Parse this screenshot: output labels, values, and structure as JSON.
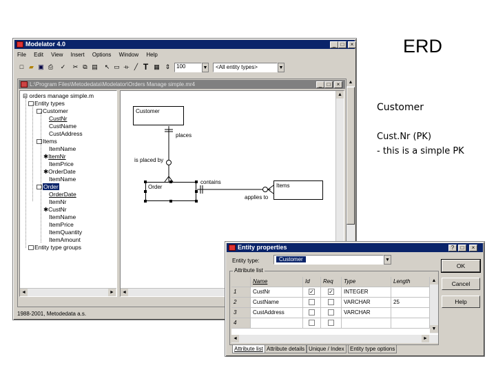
{
  "slide": {
    "title": "ERD",
    "notes": [
      "Customer",
      "Cust.Nr (PK)",
      "- this is a simple PK"
    ]
  },
  "app": {
    "title": "Modelator 4.0",
    "menu": [
      "File",
      "Edit",
      "View",
      "Insert",
      "Options",
      "Window",
      "Help"
    ],
    "zoom": "100",
    "entity_filter": "<All entity types>",
    "status": "1988-2001, Metodedata a.s."
  },
  "child": {
    "title": "L:\\Program Files\\Metodedata\\Modelator\\Orders Manage simple.mr4"
  },
  "tree": {
    "root": "orders manage simple.m",
    "entity_types": "Entity types",
    "customer": "Customer",
    "customer_attrs": [
      "CustNr",
      "CustName",
      "CustAddress"
    ],
    "items": "Items",
    "items_attrs": [
      "ItemName",
      "ItemNr",
      "ItemPrice",
      "OrderDate",
      "ItemName"
    ],
    "order": "Order",
    "order_attrs": [
      "OrderDate",
      "ItemNr",
      "CustNr",
      "ItemName",
      "ItemPrice",
      "ItemQuantity",
      "ItemAmount"
    ],
    "groups": "Entity type groups"
  },
  "diagram": {
    "customer": "Customer",
    "order": "Order",
    "items": "Items",
    "places": "places",
    "is_placed_by": "is placed by",
    "contains": "contains",
    "applies_to": "applies to"
  },
  "dialog": {
    "title": "Entity properties",
    "entity_type_label": "Entity type:",
    "entity_type_value": "Customer",
    "attribute_list_label": "Attribute list",
    "columns": [
      "Name",
      "Id",
      "Req",
      "Type",
      "Length"
    ],
    "rows": [
      {
        "num": "1",
        "name": "CustNr",
        "id": "✓",
        "req": "✓",
        "type": "INTEGER",
        "length": ""
      },
      {
        "num": "2",
        "name": "CustName",
        "id": "",
        "req": "",
        "type": "VARCHAR",
        "length": "25"
      },
      {
        "num": "3",
        "name": "CustAddress",
        "id": "",
        "req": "",
        "type": "VARCHAR",
        "length": ""
      },
      {
        "num": "4",
        "name": "",
        "id": "",
        "req": "",
        "type": "",
        "length": ""
      }
    ],
    "ok": "OK",
    "cancel": "Cancel",
    "help": "Help",
    "tabs": [
      "Attribute list",
      "Attribute details",
      "Unique / Index",
      "Entity type options"
    ]
  }
}
